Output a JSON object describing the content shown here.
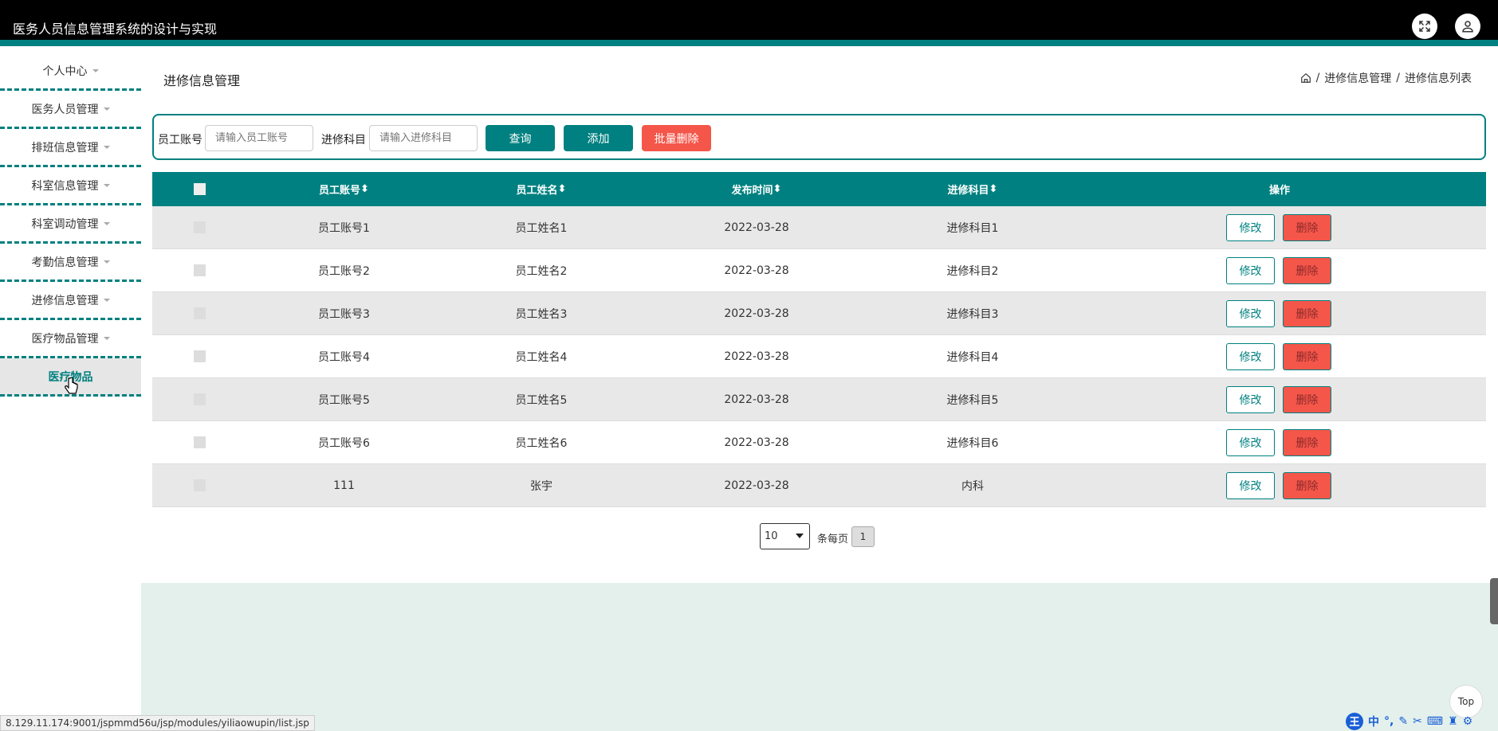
{
  "header": {
    "title": "医务人员信息管理系统的设计与实现",
    "fullscreen_icon": "expand-icon",
    "user_icon": "user-icon"
  },
  "sidebar": {
    "items": [
      {
        "label": "个人中心",
        "has_caret": true
      },
      {
        "label": "医务人员管理",
        "has_caret": true
      },
      {
        "label": "排班信息管理",
        "has_caret": true
      },
      {
        "label": "科室信息管理",
        "has_caret": true
      },
      {
        "label": "科室调动管理",
        "has_caret": true
      },
      {
        "label": "考勤信息管理",
        "has_caret": true
      },
      {
        "label": "进修信息管理",
        "has_caret": true
      },
      {
        "label": "医疗物品管理",
        "has_caret": true
      },
      {
        "label": "医疗物品",
        "has_caret": false,
        "active": true
      }
    ]
  },
  "page": {
    "title": "进修信息管理"
  },
  "breadcrumb": {
    "home_icon": "home-icon",
    "sep": "/",
    "level1": "进修信息管理",
    "level2": "进修信息列表"
  },
  "search": {
    "account_label": "员工账号",
    "account_placeholder": "请输入员工账号",
    "subject_label": "进修科目",
    "subject_placeholder": "请输入进修科目",
    "query_button": "查询",
    "add_button": "添加",
    "batch_delete_button": "批量删除"
  },
  "table": {
    "headers": [
      "员工账号",
      "员工姓名",
      "发布时间",
      "进修科目",
      "操作"
    ],
    "sort_icon": "sort-icon",
    "rows": [
      {
        "account": "员工账号1",
        "name": "员工姓名1",
        "date": "2022-03-28",
        "subject": "进修科目1"
      },
      {
        "account": "员工账号2",
        "name": "员工姓名2",
        "date": "2022-03-28",
        "subject": "进修科目2"
      },
      {
        "account": "员工账号3",
        "name": "员工姓名3",
        "date": "2022-03-28",
        "subject": "进修科目3"
      },
      {
        "account": "员工账号4",
        "name": "员工姓名4",
        "date": "2022-03-28",
        "subject": "进修科目4"
      },
      {
        "account": "员工账号5",
        "name": "员工姓名5",
        "date": "2022-03-28",
        "subject": "进修科目5"
      },
      {
        "account": "员工账号6",
        "name": "员工姓名6",
        "date": "2022-03-28",
        "subject": "进修科目6"
      },
      {
        "account": "111",
        "name": "张宇",
        "date": "2022-03-28",
        "subject": "内科"
      }
    ],
    "edit_label": "修改",
    "delete_label": "删除"
  },
  "pagination": {
    "page_size": "10",
    "per_page_text": "条每页",
    "current_page": "1"
  },
  "statusbar": {
    "url": "8.129.11.174:9001/jspmmd56u/jsp/modules/yiliaowupin/list.jsp"
  },
  "top_button": {
    "label": "Top"
  },
  "ime": {
    "logo": "王",
    "mode": "中"
  },
  "colors": {
    "primary": "#008080",
    "danger": "#f5564a",
    "header_bg": "#000000"
  }
}
